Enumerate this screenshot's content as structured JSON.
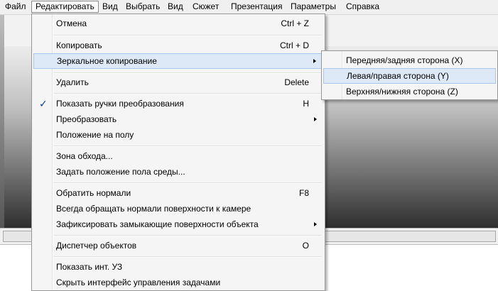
{
  "menubar": {
    "items": [
      "Файл",
      "Редактировать",
      "Вид",
      "Выбрать",
      "Вид",
      "Сюжет",
      "Презентация",
      "Параметры",
      "Справка"
    ]
  },
  "edit_menu": {
    "items": [
      {
        "label": "Отмена",
        "shortcut": "Ctrl + Z"
      },
      {
        "label": "Копировать",
        "shortcut": "Ctrl + D"
      },
      {
        "label": "Зеркальное копирование"
      },
      {
        "label": "Удалить",
        "shortcut": "Delete"
      },
      {
        "label": "Показать ручки преобразования",
        "shortcut": "H",
        "checked": true,
        "check": "✓"
      },
      {
        "label": "Преобразовать"
      },
      {
        "label": "Положение на полу"
      },
      {
        "label": "Зона обхода..."
      },
      {
        "label": "Задать положение пола среды..."
      },
      {
        "label": "Обратить нормали",
        "shortcut": "F8"
      },
      {
        "label": "Всегда обращать нормали поверхности к камере"
      },
      {
        "label": "Зафиксировать замыкающие поверхности объекта"
      },
      {
        "label": "Диспетчер объектов",
        "shortcut": "O"
      },
      {
        "label": "Показать инт. УЗ"
      },
      {
        "label": "Скрыть интерфейс управления задачами"
      }
    ]
  },
  "submenu": {
    "items": [
      {
        "label": "Передняя/задняя сторона (X)"
      },
      {
        "label": "Левая/правая сторона (Y)"
      },
      {
        "label": "Верхняя/нижняя сторона (Z)"
      }
    ]
  },
  "colors": {
    "highlight_bg": "#dde9f6",
    "highlight_border": "#a8c7ea",
    "check": "#0b3f91",
    "menu_bg": "#f5f5f5"
  }
}
